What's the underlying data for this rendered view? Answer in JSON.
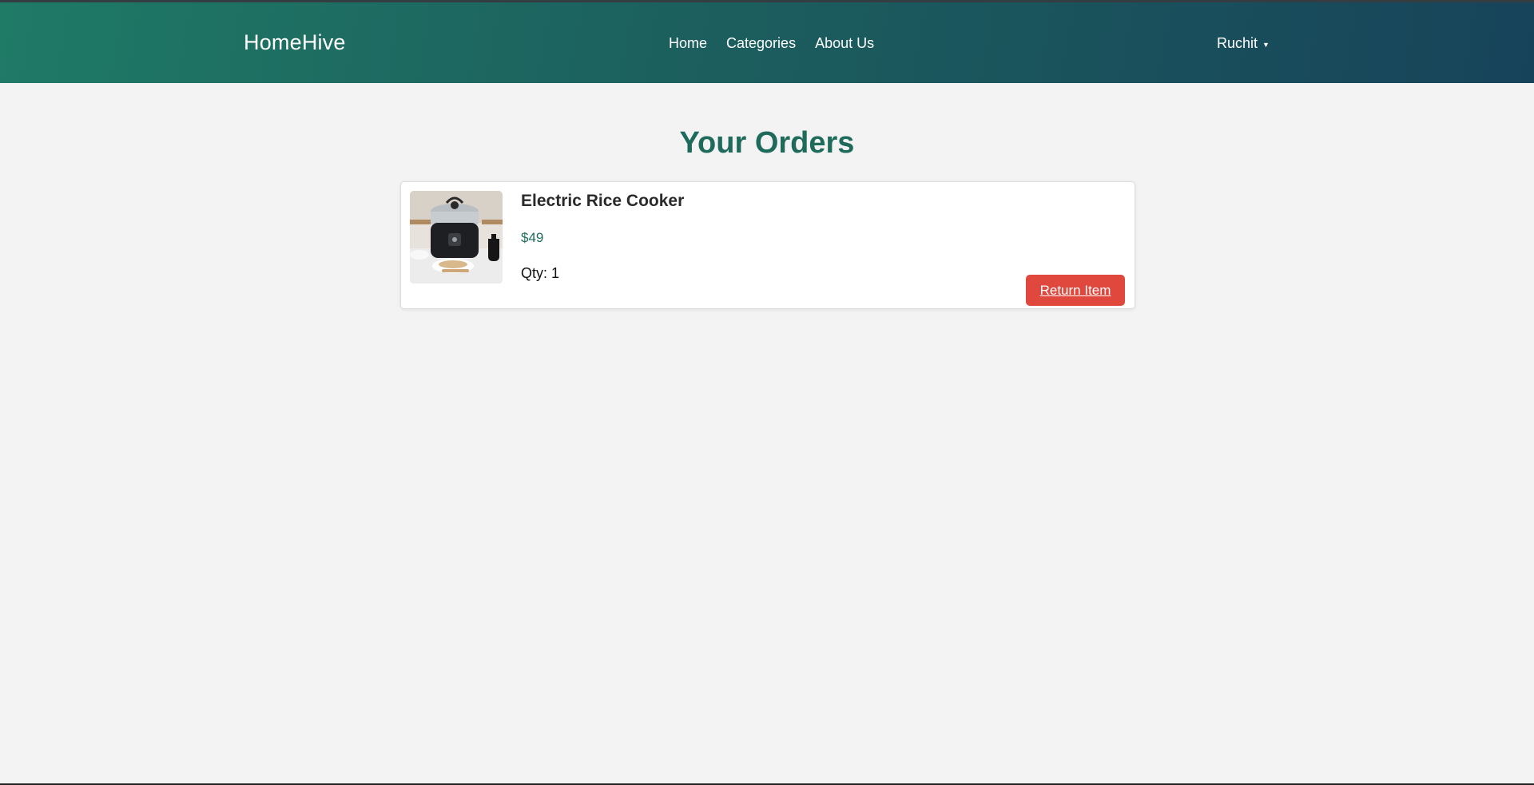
{
  "header": {
    "brand": "HomeHive",
    "nav": [
      {
        "label": "Home"
      },
      {
        "label": "Categories"
      },
      {
        "label": "About Us"
      }
    ],
    "user": {
      "name": "Ruchit",
      "menu_icon": "caret-down-icon"
    }
  },
  "page": {
    "title": "Your Orders"
  },
  "orders": [
    {
      "name": "Electric Rice Cooker",
      "price": "$49",
      "qty": "Qty: 1",
      "image_icon": "rice-cooker-image",
      "action_label": "Return Item"
    }
  ],
  "colors": {
    "header_gradient_start": "#1f7a66",
    "header_gradient_end": "#17435a",
    "title": "#1e6b5c",
    "price": "#1e6b5c",
    "return_button": "#e0473d",
    "background": "#f3f3f3"
  }
}
